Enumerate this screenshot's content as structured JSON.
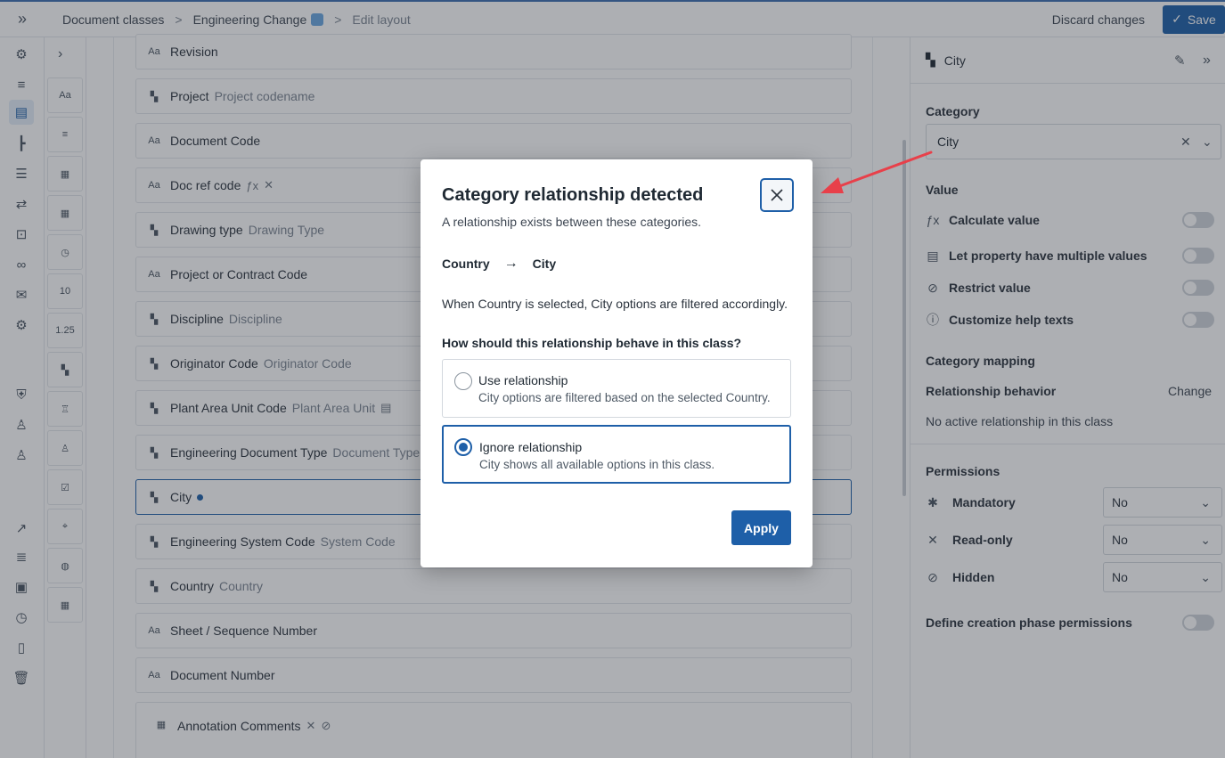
{
  "topbar": {
    "breadcrumb": [
      "Document classes",
      "Engineering Change",
      "Edit layout"
    ],
    "discard_label": "Discard changes",
    "save_label": "Save"
  },
  "rail2": {
    "tiles": [
      "Aa",
      "10",
      "1.25"
    ]
  },
  "fields": [
    {
      "type": "Aa",
      "name": "Revision",
      "sub": ""
    },
    {
      "type": "category",
      "name": "Project",
      "sub": "Project codename"
    },
    {
      "type": "Aa",
      "name": "Document Code",
      "sub": ""
    },
    {
      "type": "Aa",
      "name": "Doc ref code",
      "sub": ""
    },
    {
      "type": "category",
      "name": "Drawing type",
      "sub": "Drawing Type"
    },
    {
      "type": "Aa",
      "name": "Project or Contract Code",
      "sub": ""
    },
    {
      "type": "category",
      "name": "Discipline",
      "sub": "Discipline"
    },
    {
      "type": "category",
      "name": "Originator Code",
      "sub": "Originator Code"
    },
    {
      "type": "category",
      "name": "Plant Area Unit Code",
      "sub": "Plant Area Unit"
    },
    {
      "type": "category",
      "name": "Engineering Document Type",
      "sub": "Document Type"
    },
    {
      "type": "category",
      "name": "City",
      "sub": ""
    },
    {
      "type": "category",
      "name": "Engineering System Code",
      "sub": "System Code"
    },
    {
      "type": "category",
      "name": "Country",
      "sub": "Country"
    },
    {
      "type": "Aa",
      "name": "Sheet / Sequence Number",
      "sub": ""
    },
    {
      "type": "Aa",
      "name": "Document Number",
      "sub": ""
    },
    {
      "type": "table",
      "name": "Annotation Comments",
      "sub": ""
    }
  ],
  "panel": {
    "header_title": "City",
    "category_label": "Category",
    "category_value": "City",
    "value_label": "Value",
    "toggles": [
      "Calculate value",
      "Let property have multiple values",
      "Restrict value",
      "Customize help texts"
    ],
    "category_mapping_label": "Category mapping",
    "relationship_behavior_label": "Relationship behavior",
    "change_label": "Change",
    "no_relationship_text": "No active relationship in this class",
    "permissions_label": "Permissions",
    "permissions": [
      {
        "label": "Mandatory",
        "value": "No"
      },
      {
        "label": "Read-only",
        "value": "No"
      },
      {
        "label": "Hidden",
        "value": "No"
      }
    ],
    "creation_phase_label": "Define creation phase permissions"
  },
  "modal": {
    "title": "Category relationship detected",
    "subtitle": "A relationship exists between these categories.",
    "from": "Country",
    "to": "City",
    "description": "When Country is selected, City options are filtered accordingly.",
    "question": "How should this relationship behave in this class?",
    "options": [
      {
        "label": "Use relationship",
        "description": "City options are filtered based on the selected Country.",
        "selected": false
      },
      {
        "label": "Ignore relationship",
        "description": "City shows all available options in this class.",
        "selected": true
      }
    ],
    "apply_label": "Apply"
  },
  "colors": {
    "accent": "#1e5fa8",
    "annotation_arrow": "#e8404a"
  }
}
